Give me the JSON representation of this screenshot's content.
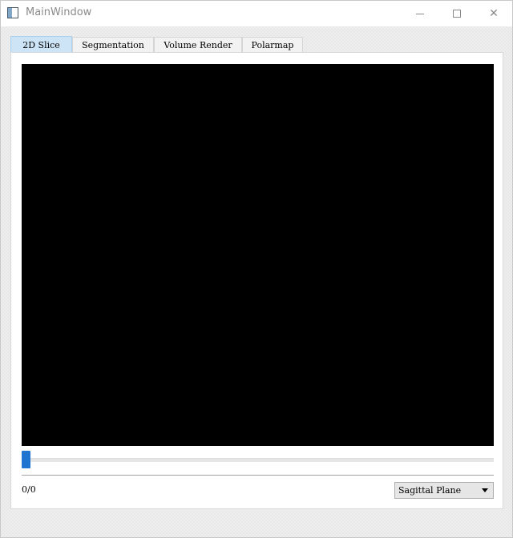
{
  "window": {
    "title": "MainWindow"
  },
  "icons": {
    "app": "app-window-icon",
    "minimize": "minimize-icon",
    "maximize": "maximize-icon",
    "close": "close-icon",
    "dropdown": "chevron-down-icon"
  },
  "tabs": [
    {
      "label": "2D Slice",
      "active": true
    },
    {
      "label": "Segmentation",
      "active": false
    },
    {
      "label": "Volume Render",
      "active": false
    },
    {
      "label": "Polarmap",
      "active": false
    }
  ],
  "slice_view": {
    "background": "#000000"
  },
  "slider": {
    "value": 0,
    "max": 0,
    "handle_color": "#1e74d1"
  },
  "status": {
    "counter": "0/0"
  },
  "plane_select": {
    "selected": "Sagittal Plane"
  },
  "colors": {
    "active_tab": "#cde4f6",
    "accent": "#1e74d1"
  }
}
